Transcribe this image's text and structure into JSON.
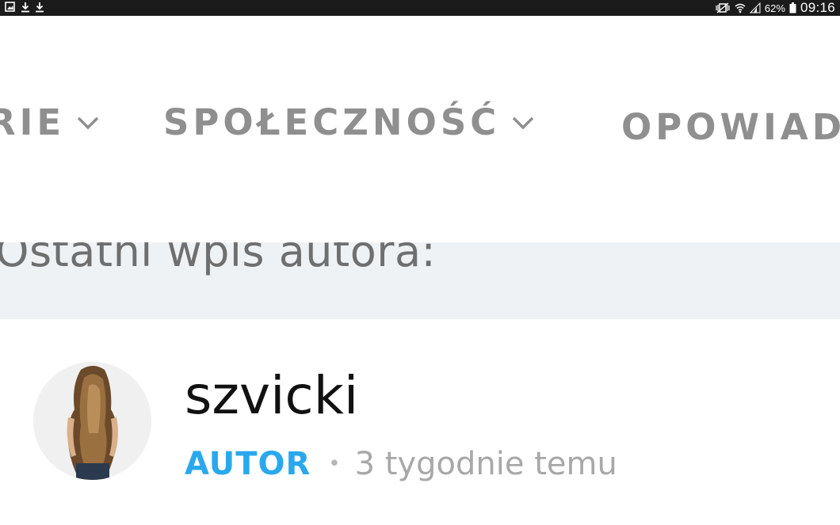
{
  "status_bar": {
    "left_icons": [
      "image-notification-icon",
      "download-icon",
      "download-icon"
    ],
    "right_icons": [
      "mute-vibrate-icon",
      "wifi-icon",
      "signal-icon"
    ],
    "battery_percent": "62%",
    "battery_icon": "battery-icon",
    "clock": "09:16"
  },
  "nav": {
    "items": [
      {
        "label": "RIE",
        "has_dropdown": true,
        "dropdown_icon": "chevron-down-icon"
      },
      {
        "label": "SPOŁECZNOŚĆ",
        "has_dropdown": true,
        "dropdown_icon": "chevron-down-icon"
      },
      {
        "label": "OPOWIAD",
        "has_dropdown": false
      }
    ],
    "text_color": "#8f8f8f"
  },
  "recent_post": {
    "heading": "Ostatni wpis autora:",
    "background": "#eff2f5"
  },
  "author": {
    "name": "szvicki",
    "role": "AUTOR",
    "separator": "•",
    "time_ago": "3 tygodnie temu",
    "avatar_icon": "avatar-photo",
    "role_color": "#2aa8ee"
  }
}
